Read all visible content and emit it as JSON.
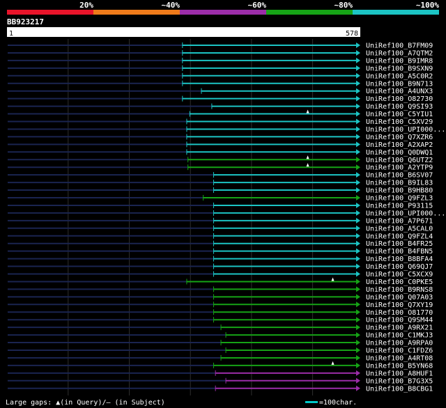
{
  "query_id": "BB923217",
  "footer": {
    "gaps_text": "Large gaps: ▲(in Query)/– (in Subject)",
    "legend_text": "=100char.",
    "legend_color": "#00c8c8"
  },
  "chart_data": {
    "type": "alignment",
    "identity_scale": [
      {
        "label": "20%",
        "color": "#e8142a"
      },
      {
        "label": "~40%",
        "color": "#ee7a1a"
      },
      {
        "label": "~60%",
        "color": "#9b2da8"
      },
      {
        "label": "~80%",
        "color": "#16a316"
      },
      {
        "label": "~100%",
        "color": "#1cc4c4"
      }
    ],
    "query_range": [
      1,
      578
    ],
    "query_start_label": "1",
    "query_end_label": "578",
    "hits": [
      {
        "name": "UniRef100_B7FM09",
        "start": 287,
        "end": 578,
        "identity": 5,
        "gaps": []
      },
      {
        "name": "UniRef100_A7QTM2",
        "start": 287,
        "end": 578,
        "identity": 5,
        "gaps": []
      },
      {
        "name": "UniRef100_B9IMR8",
        "start": 287,
        "end": 578,
        "identity": 5,
        "gaps": []
      },
      {
        "name": "UniRef100_B9SXN9",
        "start": 287,
        "end": 578,
        "identity": 5,
        "gaps": []
      },
      {
        "name": "UniRef100_A5C0R2",
        "start": 287,
        "end": 578,
        "identity": 5,
        "gaps": []
      },
      {
        "name": "UniRef100_B9N713",
        "start": 287,
        "end": 578,
        "identity": 5,
        "gaps": []
      },
      {
        "name": "UniRef100_A4UNX3",
        "start": 318,
        "end": 578,
        "identity": 5,
        "gaps": []
      },
      {
        "name": "UniRef100_O82730",
        "start": 287,
        "end": 578,
        "identity": 5,
        "gaps": []
      },
      {
        "name": "UniRef100_Q9SI93",
        "start": 335,
        "end": 578,
        "identity": 5,
        "gaps": []
      },
      {
        "name": "UniRef100_C5YIU1",
        "start": 299,
        "end": 578,
        "identity": 5,
        "gaps": [
          492
        ]
      },
      {
        "name": "UniRef100_C5XV29",
        "start": 294,
        "end": 578,
        "identity": 5,
        "gaps": []
      },
      {
        "name": "UniRef100_UPI000...",
        "start": 294,
        "end": 578,
        "identity": 5,
        "gaps": []
      },
      {
        "name": "UniRef100_Q7XZR6",
        "start": 294,
        "end": 578,
        "identity": 5,
        "gaps": []
      },
      {
        "name": "UniRef100_A2XAP2",
        "start": 294,
        "end": 578,
        "identity": 5,
        "gaps": []
      },
      {
        "name": "UniRef100_Q0DWQ1",
        "start": 294,
        "end": 578,
        "identity": 5,
        "gaps": []
      },
      {
        "name": "UniRef100_Q6UTZ2",
        "start": 296,
        "end": 578,
        "identity": 4,
        "gaps": [
          492
        ]
      },
      {
        "name": "UniRef100_A2YTP9",
        "start": 296,
        "end": 578,
        "identity": 4,
        "gaps": [
          492
        ]
      },
      {
        "name": "UniRef100_B6SV07",
        "start": 338,
        "end": 578,
        "identity": 5,
        "gaps": []
      },
      {
        "name": "UniRef100_B9IL83",
        "start": 338,
        "end": 578,
        "identity": 5,
        "gaps": []
      },
      {
        "name": "UniRef100_B9HB80",
        "start": 338,
        "end": 578,
        "identity": 5,
        "gaps": []
      },
      {
        "name": "UniRef100_Q9FZL3",
        "start": 321,
        "end": 578,
        "identity": 4,
        "gaps": []
      },
      {
        "name": "UniRef100_P93115",
        "start": 338,
        "end": 578,
        "identity": 5,
        "gaps": []
      },
      {
        "name": "UniRef100_UPI000...",
        "start": 338,
        "end": 578,
        "identity": 5,
        "gaps": []
      },
      {
        "name": "UniRef100_A7P671",
        "start": 338,
        "end": 578,
        "identity": 5,
        "gaps": []
      },
      {
        "name": "UniRef100_A5CAL0",
        "start": 338,
        "end": 578,
        "identity": 5,
        "gaps": []
      },
      {
        "name": "UniRef100_Q9FZL4",
        "start": 338,
        "end": 578,
        "identity": 5,
        "gaps": []
      },
      {
        "name": "UniRef100_B4FR25",
        "start": 338,
        "end": 578,
        "identity": 5,
        "gaps": []
      },
      {
        "name": "UniRef100_B4FBN5",
        "start": 338,
        "end": 578,
        "identity": 5,
        "gaps": []
      },
      {
        "name": "UniRef100_B8BFA4",
        "start": 338,
        "end": 578,
        "identity": 5,
        "gaps": []
      },
      {
        "name": "UniRef100_Q69QJ7",
        "start": 338,
        "end": 578,
        "identity": 5,
        "gaps": []
      },
      {
        "name": "UniRef100_C5XCX9",
        "start": 338,
        "end": 578,
        "identity": 5,
        "gaps": []
      },
      {
        "name": "UniRef100_C0PKE5",
        "start": 294,
        "end": 578,
        "identity": 4,
        "gaps": [
          533
        ]
      },
      {
        "name": "UniRef100_B9RNS8",
        "start": 338,
        "end": 578,
        "identity": 4,
        "gaps": []
      },
      {
        "name": "UniRef100_Q07A03",
        "start": 338,
        "end": 578,
        "identity": 4,
        "gaps": []
      },
      {
        "name": "UniRef100_Q7XY19",
        "start": 338,
        "end": 578,
        "identity": 4,
        "gaps": []
      },
      {
        "name": "UniRef100_O81770",
        "start": 338,
        "end": 578,
        "identity": 4,
        "gaps": []
      },
      {
        "name": "UniRef100_Q9SM44",
        "start": 338,
        "end": 578,
        "identity": 4,
        "gaps": []
      },
      {
        "name": "UniRef100_A9RX21",
        "start": 350,
        "end": 578,
        "identity": 4,
        "gaps": []
      },
      {
        "name": "UniRef100_C1MKJ3",
        "start": 358,
        "end": 578,
        "identity": 4,
        "gaps": []
      },
      {
        "name": "UniRef100_A9RPA0",
        "start": 350,
        "end": 578,
        "identity": 4,
        "gaps": []
      },
      {
        "name": "UniRef100_C1FDZ6",
        "start": 358,
        "end": 578,
        "identity": 4,
        "gaps": []
      },
      {
        "name": "UniRef100_A4RT08",
        "start": 350,
        "end": 578,
        "identity": 4,
        "gaps": []
      },
      {
        "name": "UniRef100_B5YN68",
        "start": 338,
        "end": 578,
        "identity": 4,
        "gaps": [
          533
        ]
      },
      {
        "name": "UniRef100_A8HUF1",
        "start": 341,
        "end": 578,
        "identity": 3,
        "gaps": []
      },
      {
        "name": "UniRef100_B7G3X5",
        "start": 358,
        "end": 578,
        "identity": 3,
        "gaps": []
      },
      {
        "name": "UniRef100_B8CBG1",
        "start": 341,
        "end": 578,
        "identity": 3,
        "gaps": []
      }
    ]
  }
}
